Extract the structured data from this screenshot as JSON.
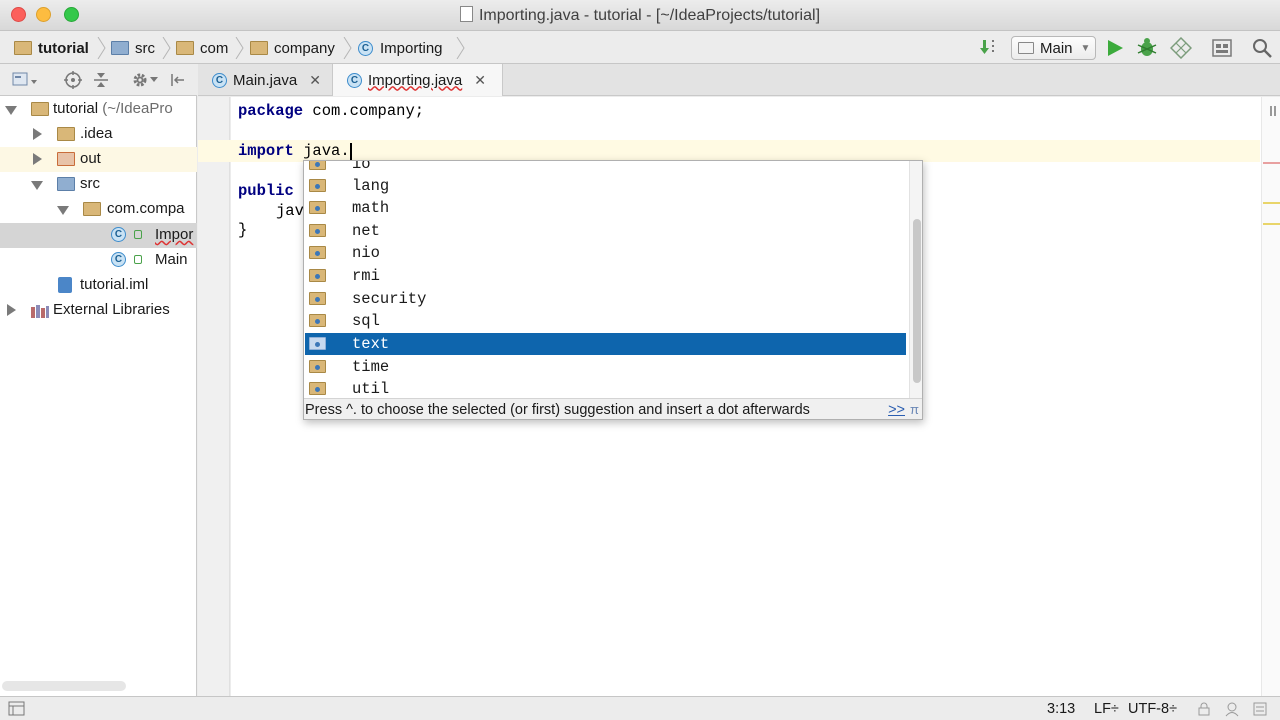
{
  "window": {
    "title": "Importing.java - tutorial - [~/IdeaProjects/tutorial]"
  },
  "navbar": {
    "crumbs": [
      {
        "label": "tutorial",
        "icon": "project-folder-icon"
      },
      {
        "label": "src",
        "icon": "source-folder-icon"
      },
      {
        "label": "com",
        "icon": "package-folder-icon"
      },
      {
        "label": "company",
        "icon": "package-folder-icon"
      },
      {
        "label": "Importing",
        "icon": "class-icon"
      }
    ],
    "run_config": "Main"
  },
  "project_tree": {
    "items": [
      {
        "label": "tutorial",
        "suffix": "(~/IdeaPro",
        "expanded": true
      },
      {
        "label": ".idea",
        "expanded": false
      },
      {
        "label": "out",
        "expanded": false
      },
      {
        "label": "src",
        "expanded": true
      },
      {
        "label": "com.compa",
        "expanded": true
      },
      {
        "label": "Impor",
        "selected": true
      },
      {
        "label": "Main"
      },
      {
        "label": "tutorial.iml"
      },
      {
        "label": "External Libraries",
        "expanded": false
      }
    ]
  },
  "tabs": [
    {
      "label": "Main.java",
      "close": "✕"
    },
    {
      "label": "Importing.java",
      "close": "✕",
      "active": true
    }
  ],
  "editor": {
    "lines": {
      "l1_kw": "package",
      "l1_rest": " com.company;",
      "l3_kw": "import",
      "l3_rest": " java.",
      "l5_kw": "public",
      "l6": "jav",
      "l7": "}"
    }
  },
  "completion": {
    "partial_top": "io",
    "items": [
      "lang",
      "math",
      "net",
      "nio",
      "rmi",
      "security",
      "sql",
      "text",
      "time",
      "util"
    ],
    "selected": "text",
    "hint": "Press ^. to choose the selected (or first) suggestion and insert a dot afterwards",
    "more_link": ">>",
    "pi_symbol": "π"
  },
  "statusbar": {
    "position": "3:13",
    "line_sep": "LF÷",
    "encoding": "UTF-8÷"
  },
  "colors": {
    "selection": "#0e65ad",
    "keyword": "#000080",
    "caret_line": "#fffae3"
  }
}
